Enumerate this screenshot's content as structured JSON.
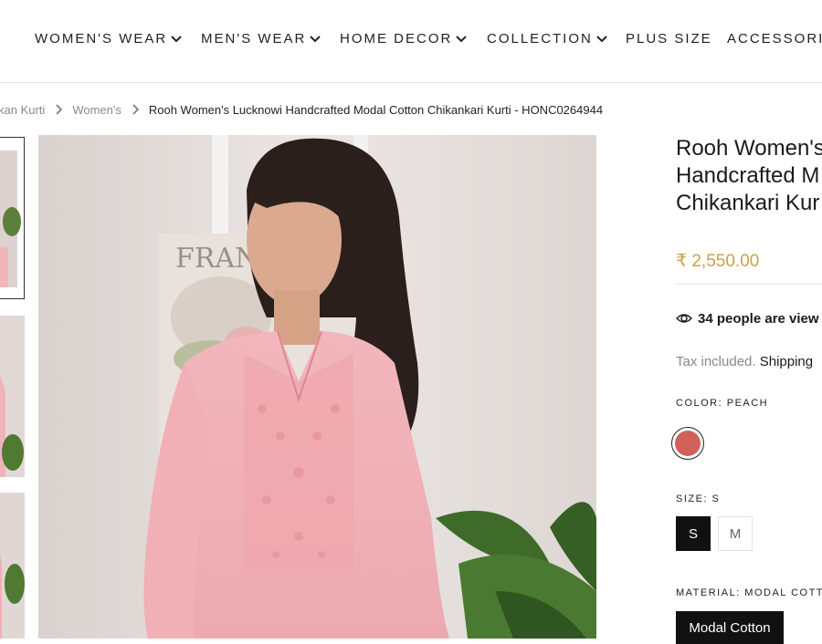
{
  "nav": {
    "items": [
      {
        "label": "WOMEN'S WEAR",
        "has_dropdown": true
      },
      {
        "label": "MEN'S WEAR",
        "has_dropdown": true
      },
      {
        "label": "HOME DECOR",
        "has_dropdown": true
      },
      {
        "label": "COLLECTION",
        "has_dropdown": true
      },
      {
        "label": "PLUS SIZE",
        "has_dropdown": false
      },
      {
        "label": "ACCESSORIE",
        "has_dropdown": false
      }
    ]
  },
  "breadcrumb": {
    "items": [
      "kan Kurti",
      "Women's"
    ],
    "current": "Rooh Women's Lucknowi Handcrafted Modal Cotton Chikankari Kurti - HONC0264944"
  },
  "image": {
    "poster_text": "FRAN",
    "colors": {
      "wall": "#eae4e2",
      "kurti": "#eeb4b9",
      "plant": "#3f6b2a"
    }
  },
  "product": {
    "title_lines": [
      "Rooh Women's",
      "Handcrafted M",
      "Chikankari Kur"
    ],
    "price": "₹ 2,550.00",
    "viewers": "34 people are view",
    "tax_prefix": "Tax included.",
    "shipping": "Shipping",
    "color_label": "COLOR: PEACH",
    "swatch_color": "#d0605a",
    "size_label": "SIZE: S",
    "sizes": [
      "S",
      "M"
    ],
    "selected_size": "S",
    "material_label": "MATERIAL: MODAL COTTO",
    "material": "Modal Cotton",
    "price_color": "#c8a24a"
  },
  "icons": {
    "nav_dropdown": "chevron-down-icon",
    "breadcrumb_separator": "chevron-right-icon",
    "viewers": "eye-icon"
  }
}
